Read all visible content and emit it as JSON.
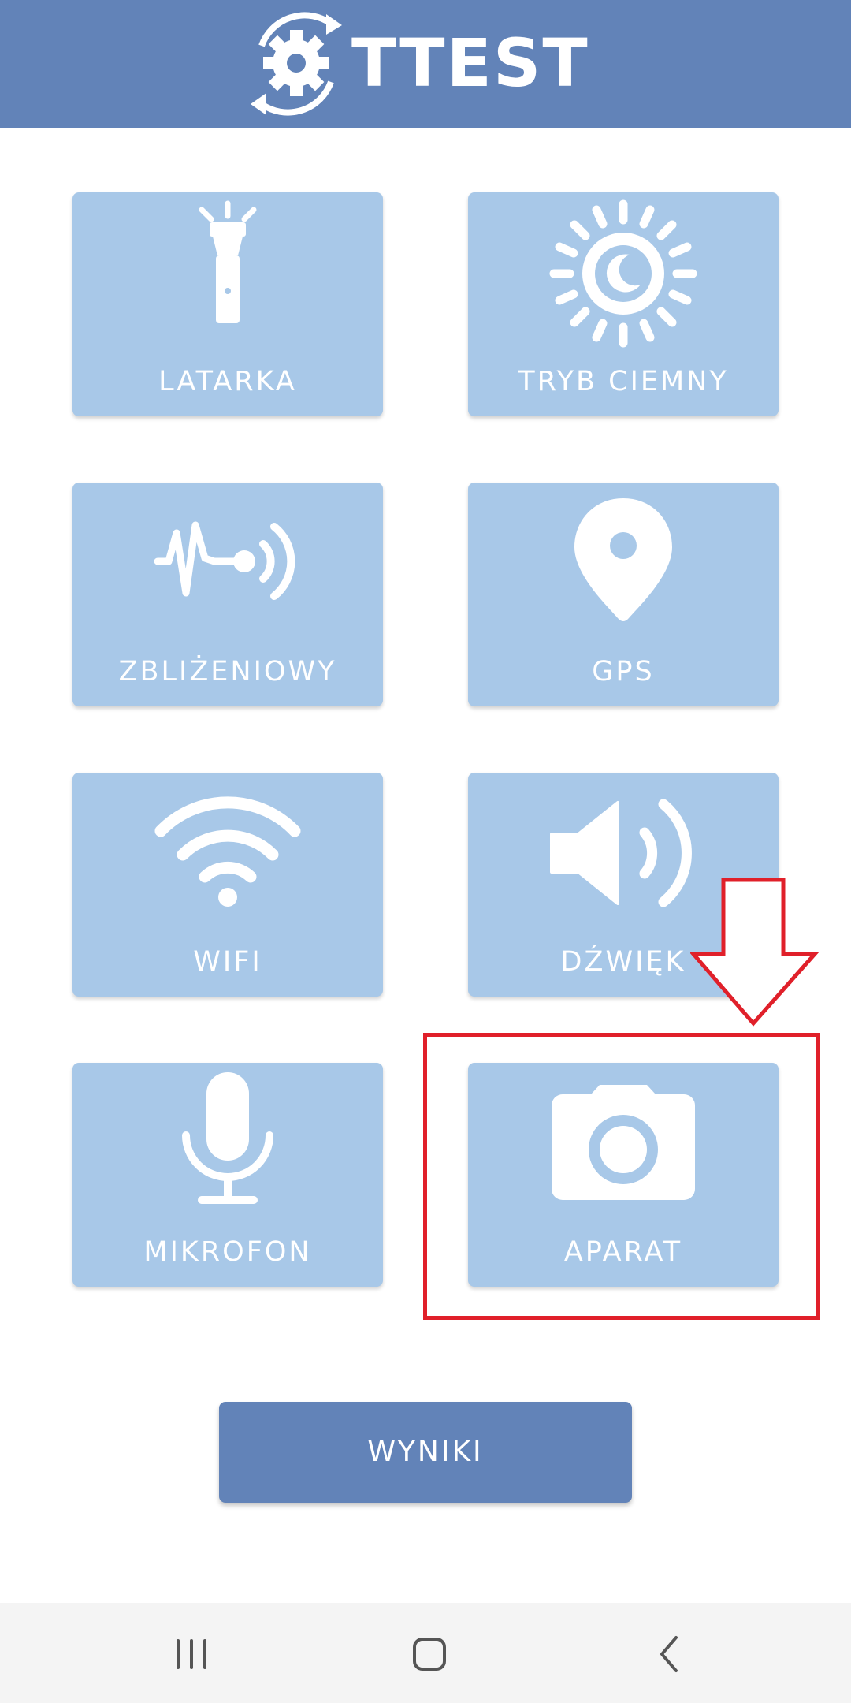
{
  "header": {
    "app_name": "TTEST",
    "logo_icon": "gear-sync-icon",
    "color": "#6283b8"
  },
  "tiles": [
    {
      "label": "LATARKA",
      "icon": "flashlight-icon"
    },
    {
      "label": "TRYB CIEMNY",
      "icon": "dark-mode-icon"
    },
    {
      "label": "ZBLIŻENIOWY",
      "icon": "proximity-sensor-icon"
    },
    {
      "label": "GPS",
      "icon": "location-pin-icon"
    },
    {
      "label": "WIFI",
      "icon": "wifi-icon"
    },
    {
      "label": "DŹWIĘK",
      "icon": "speaker-icon"
    },
    {
      "label": "MIKROFON",
      "icon": "microphone-icon"
    },
    {
      "label": "APARAT",
      "icon": "camera-icon"
    }
  ],
  "tile_color": "#a8c8e8",
  "results_button": {
    "label": "WYNIKI"
  },
  "annotation": {
    "color": "#e0202a"
  },
  "navbar": {
    "items": [
      "recent-apps-icon",
      "home-icon",
      "back-icon"
    ]
  }
}
